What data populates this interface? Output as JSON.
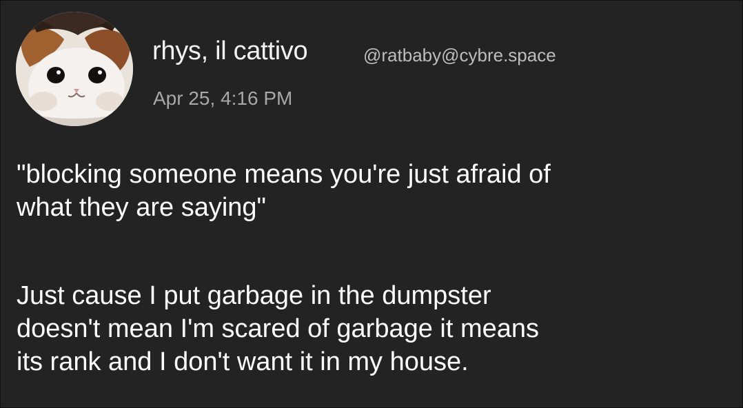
{
  "post": {
    "avatar_icon": "cat-photo-avatar",
    "display_name": "rhys, il cattivo",
    "handle": "@ratbaby@cybre.space",
    "timestamp": "Apr 25, 4:16 PM",
    "paragraphs": [
      "\"blocking someone means you're just afraid of\nwhat they are saying\"",
      "Just cause I put garbage in the dumpster\ndoesn't mean I'm scared of garbage it means\nits rank and I don't want it in my house."
    ]
  },
  "colors": {
    "background": "#232323",
    "text_primary": "#ffffff",
    "text_secondary": "#a8a8a8"
  }
}
